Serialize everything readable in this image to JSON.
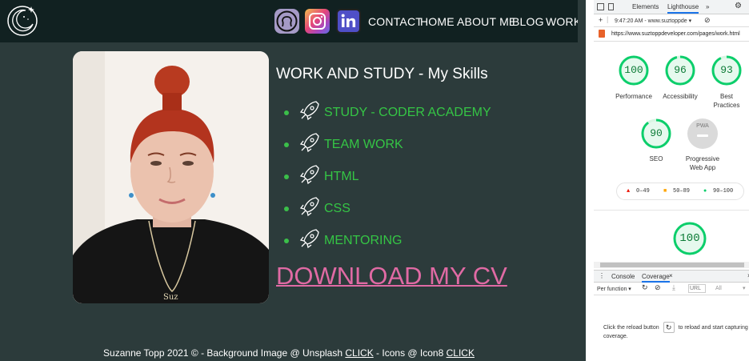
{
  "nav": {
    "links": [
      "CONTACT",
      "HOME",
      "ABOUT ME",
      "BLOG",
      "WORK"
    ],
    "icons": [
      "github-icon",
      "instagram-icon",
      "linkedin-icon"
    ]
  },
  "main": {
    "heading": "WORK AND STUDY - My Skills",
    "skills": [
      "STUDY - CODER ACADEMY",
      "TEAM WORK",
      "HTML",
      "CSS",
      "MENTORING"
    ],
    "cv_link": "DOWNLOAD MY CV"
  },
  "footer": {
    "text1": "Suzanne Topp 2021 © - Background Image @ Unsplash ",
    "link1": "CLICK",
    "text2": " - Icons @ Icon8 ",
    "link2": "CLICK"
  },
  "colors": {
    "site_bg": "#2c3b3b",
    "nav_bg": "#112121",
    "skill_green": "#35c545",
    "cv_pink": "#e06aa4",
    "score_green": "#0cce6b"
  },
  "devtools": {
    "tabs": [
      "Elements",
      "Lighthouse",
      "»"
    ],
    "active_tab": "Lighthouse",
    "report_select": "9:47:20 AM - www.suztoppde ▾",
    "url": "https://www.suztoppdeveloper.com/pages/work.html",
    "scores": [
      {
        "value": "100",
        "label": "Performance"
      },
      {
        "value": "96",
        "label": "Accessibility"
      },
      {
        "value": "93",
        "label": "Best Practices"
      },
      {
        "value": "90",
        "label": "SEO"
      }
    ],
    "pwa": {
      "badge": "PWA",
      "label": "Progressive Web App"
    },
    "legend": [
      "0–49",
      "50–89",
      "90–100"
    ],
    "big_score": "100",
    "drawer_tabs": [
      "Console",
      "Coverage"
    ],
    "per_function": "Per function ▾",
    "url_filter_placeholder": "URL",
    "all_select": "All",
    "coverage_msg_before": "Click the reload button",
    "coverage_msg_after": "to reload and start capturing coverage."
  }
}
